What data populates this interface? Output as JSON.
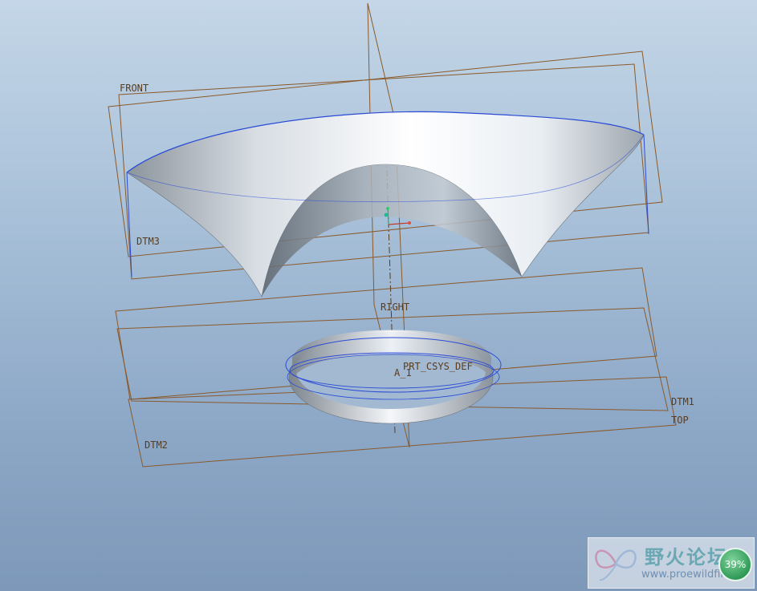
{
  "datums": {
    "front": "FRONT",
    "right": "RIGHT",
    "top": "TOP",
    "dtm1": "DTM1",
    "dtm2": "DTM2",
    "dtm3": "DTM3",
    "csys": "PRT_CSYS_DEF",
    "axis": "A_1"
  },
  "watermark": {
    "title": "野火论坛",
    "url": "www.proewildfire.cn"
  },
  "zoom_badge": "39%",
  "colors": {
    "datum_plane": "#8a5a2b",
    "edge_highlight": "#2a4bd6",
    "surface_light": "#f2f5f9",
    "surface_dark": "#7f8790",
    "badge": "#2f9a58"
  }
}
